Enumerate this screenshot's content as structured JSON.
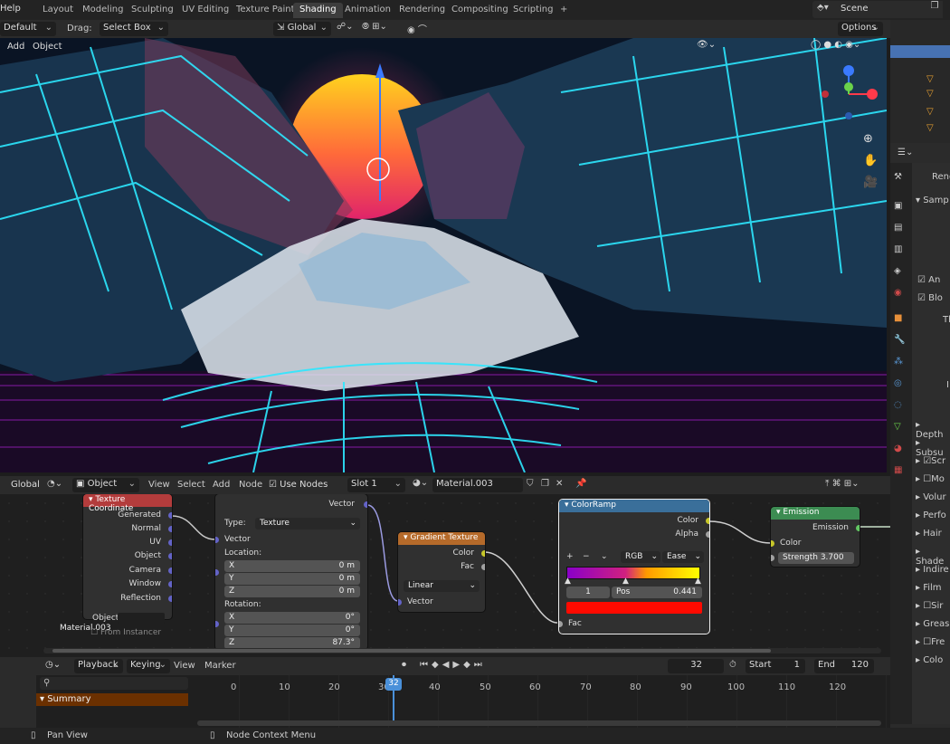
{
  "topbar": {
    "menu_help": "Help",
    "workspaces": [
      "Layout",
      "Modeling",
      "Sculpting",
      "UV Editing",
      "Texture Paint",
      "Shading",
      "Animation",
      "Rendering",
      "Compositing",
      "Scripting"
    ],
    "active_workspace": "Shading",
    "add_tab": "+",
    "scene_label": "Scene"
  },
  "viewport_header": {
    "mode": "Default",
    "drag_label": "Drag:",
    "select_tool": "Select Box",
    "orientation": "Global",
    "options": "Options",
    "menu_add": "Add",
    "menu_object": "Object"
  },
  "properties": {
    "render_label": "Rend",
    "rows": [
      "Samp",
      "An",
      "Blo",
      "Th",
      "I",
      "Depth",
      "Subsu",
      "Scr",
      "Mo",
      "Volur",
      "Perfo",
      "Hair",
      "Shade",
      "Indire",
      "Film",
      "Sir",
      "Greas",
      "Fre",
      "Colo"
    ]
  },
  "node_header": {
    "pivot": "Global",
    "object_type": "Object",
    "menus": [
      "View",
      "Select",
      "Add",
      "Node"
    ],
    "use_nodes": "Use Nodes",
    "slot": "Slot 1",
    "material": "Material.003"
  },
  "nodes": {
    "texcoord": {
      "title": "Texture Coordinate",
      "outputs": [
        "Generated",
        "Normal",
        "UV",
        "Object",
        "Camera",
        "Window",
        "Reflection"
      ],
      "object_label": "Object",
      "from_instancer": "From Instancer"
    },
    "mapping": {
      "out_vector": "Vector",
      "type_label": "Type:",
      "type_value": "Texture",
      "in_vector": "Vector",
      "location_label": "Location:",
      "rotation_label": "Rotation:",
      "loc": [
        {
          "axis": "X",
          "val": "0 m"
        },
        {
          "axis": "Y",
          "val": "0 m"
        },
        {
          "axis": "Z",
          "val": "0 m"
        }
      ],
      "rot": [
        {
          "axis": "X",
          "val": "0°"
        },
        {
          "axis": "Y",
          "val": "0°"
        },
        {
          "axis": "Z",
          "val": "87.3°"
        }
      ]
    },
    "gradient": {
      "title": "Gradient Texture",
      "out_color": "Color",
      "out_fac": "Fac",
      "interp": "Linear",
      "in_vector": "Vector"
    },
    "colorramp": {
      "title": "ColorRamp",
      "out_color": "Color",
      "out_alpha": "Alpha",
      "plus": "+",
      "minus": "−",
      "mode": "RGB",
      "interp": "Ease",
      "index": "1",
      "pos_label": "Pos",
      "pos_value": "0.441",
      "in_fac": "Fac"
    },
    "emission": {
      "title": "Emission",
      "out": "Emission",
      "in_color": "Color",
      "strength_label": "Strength",
      "strength_value": "3.700"
    },
    "material_label": "Material.003"
  },
  "timeline": {
    "menus": [
      "Playback",
      "Keying",
      "View",
      "Marker"
    ],
    "current_frame": "32",
    "start_label": "Start",
    "start_value": "1",
    "end_label": "End",
    "end_value": "120",
    "summary": "Summary",
    "ruler": [
      "0",
      "10",
      "20",
      "30",
      "40",
      "50",
      "60",
      "70",
      "80",
      "90",
      "100",
      "110",
      "120"
    ],
    "playhead": "32"
  },
  "status": {
    "left": "Pan View",
    "right": "Node Context Menu"
  },
  "colors": {
    "active_tab": "#3d3d3d",
    "colorramp_header": "#3a6f9a",
    "texcoord_header": "#b33c3c",
    "gradient_header": "#b56a2a",
    "emission_header": "#3c8c52",
    "playhead": "#4a90d9"
  }
}
